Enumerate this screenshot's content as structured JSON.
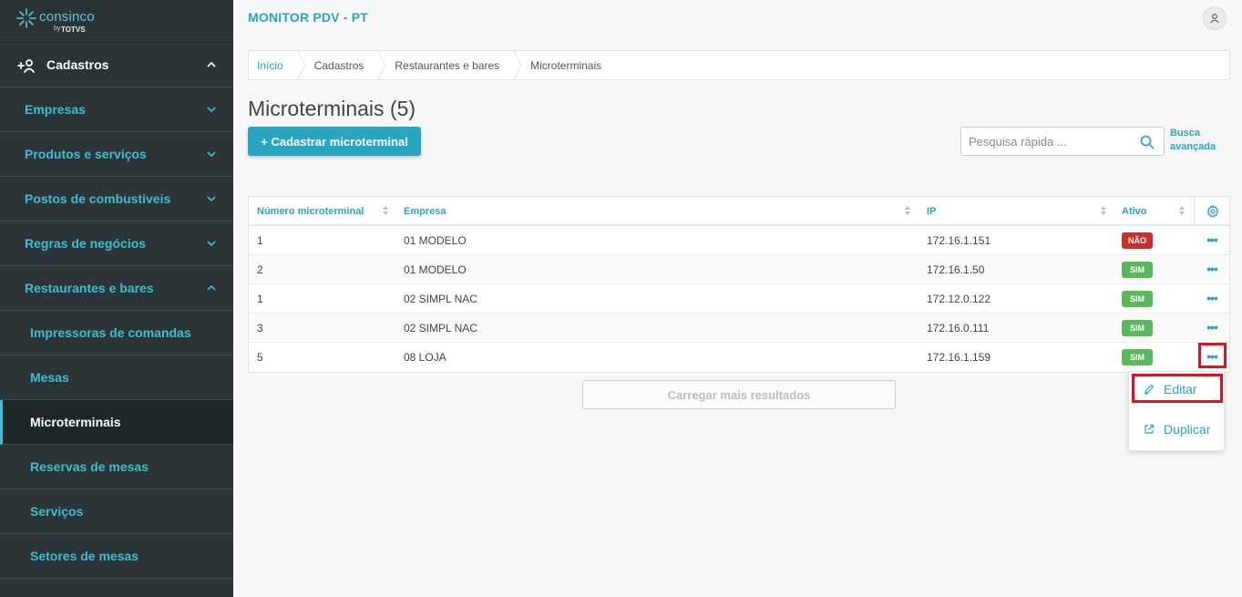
{
  "brand": {
    "name": "consinco",
    "by": "by",
    "totvs": "TOTVS"
  },
  "app": {
    "title": "MONITOR PDV - PT"
  },
  "sidebar": {
    "section": {
      "label": "Cadastros"
    },
    "categories": [
      {
        "label": "Empresas"
      },
      {
        "label": "Produtos e serviços"
      },
      {
        "label": "Postos de combustiveis"
      },
      {
        "label": "Regras de negócios"
      },
      {
        "label": "Restaurantes e bares"
      }
    ],
    "subitems": [
      {
        "label": "Impressoras de comandas"
      },
      {
        "label": "Mesas"
      },
      {
        "label": "Microterminais"
      },
      {
        "label": "Reservas de mesas"
      },
      {
        "label": "Serviços"
      },
      {
        "label": "Setores de mesas"
      }
    ]
  },
  "breadcrumb": [
    "Início",
    "Cadastros",
    "Restaurantes e bares",
    "Microterminais"
  ],
  "page": {
    "title": "Microterminais (5)",
    "new_button": "+ Cadastrar microterminal",
    "search_placeholder": "Pesquisa rápida ...",
    "advanced_search": "Busca avançada",
    "load_more": "Carregar mais resultados"
  },
  "table": {
    "columns": [
      "Número microterminal",
      "Empresa",
      "IP",
      "Ativo"
    ],
    "rows": [
      {
        "numero": "1",
        "empresa": "01 MODELO",
        "ip": "172.16.1.151",
        "ativo": "NÃO",
        "status": "inactive"
      },
      {
        "numero": "2",
        "empresa": "01 MODELO",
        "ip": "172.16.1.50",
        "ativo": "SIM",
        "status": "active"
      },
      {
        "numero": "1",
        "empresa": "02 SIMPL NAC",
        "ip": "172.12.0.122",
        "ativo": "SIM",
        "status": "active"
      },
      {
        "numero": "3",
        "empresa": "02 SIMPL NAC",
        "ip": "172.16.0.111",
        "ativo": "SIM",
        "status": "active"
      },
      {
        "numero": "5",
        "empresa": "08 LOJA",
        "ip": "172.16.1.159",
        "ativo": "SIM",
        "status": "active"
      }
    ]
  },
  "row_menu": {
    "edit": "Editar",
    "duplicate": "Duplicar"
  },
  "colors": {
    "accent": "#2ba3bd",
    "sidebar_bg": "#2b3538",
    "badge_yes": "#5cb85c",
    "badge_no": "#c9302c",
    "highlight": "#e0121b"
  }
}
